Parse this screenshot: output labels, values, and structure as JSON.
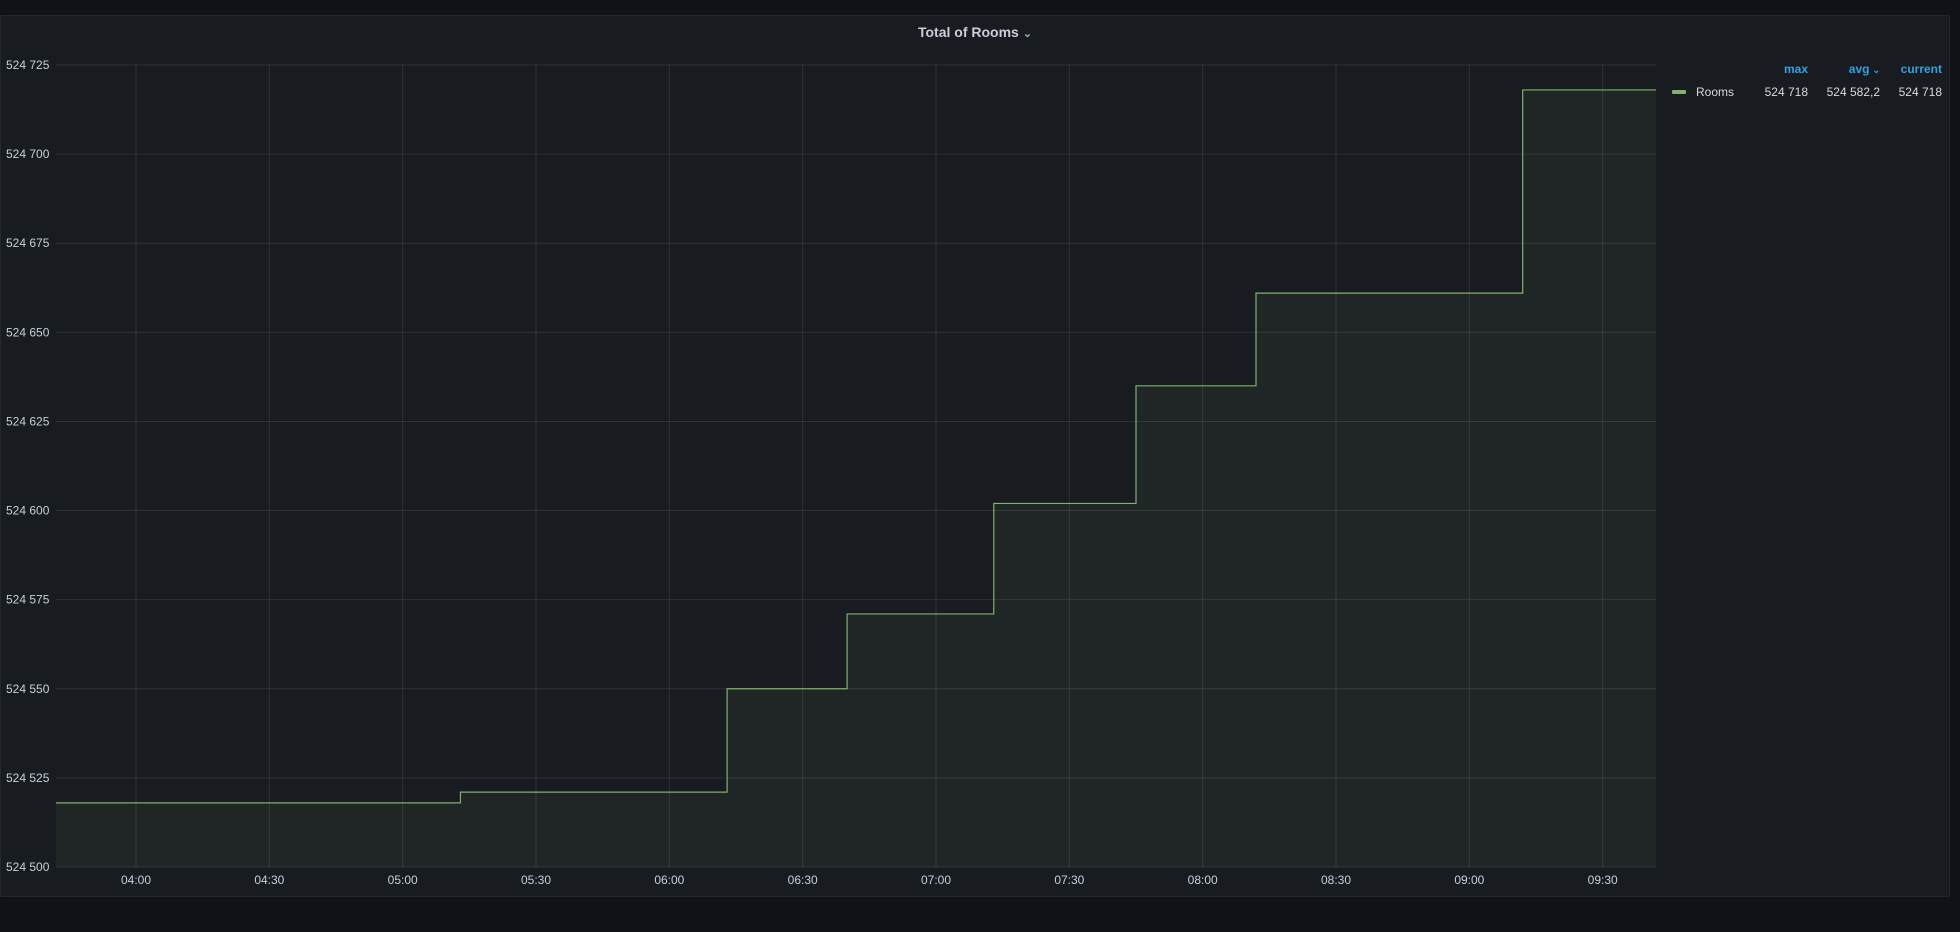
{
  "panel": {
    "title": "Total of Rooms",
    "menu_icon": "chevron-down-icon"
  },
  "legend": {
    "headers": {
      "max": "max",
      "avg": "avg",
      "current": "current"
    },
    "sort_icon": "chevron-down-icon",
    "series": [
      {
        "name": "Rooms",
        "color": "#7eb26d",
        "max": "524 718",
        "avg": "524 582,2",
        "current": "524 718"
      }
    ]
  },
  "chart_data": {
    "type": "area",
    "title": "Total of Rooms",
    "xlabel": "",
    "ylabel": "",
    "grid": true,
    "legend_position": "right",
    "step": true,
    "ylim": [
      524500,
      524725
    ],
    "xlim": [
      "03:42",
      "09:42"
    ],
    "yticks": [
      {
        "value": 524725,
        "label": "524 725"
      },
      {
        "value": 524700,
        "label": "524 700"
      },
      {
        "value": 524675,
        "label": "524 675"
      },
      {
        "value": 524650,
        "label": "524 650"
      },
      {
        "value": 524625,
        "label": "524 625"
      },
      {
        "value": 524600,
        "label": "524 600"
      },
      {
        "value": 524575,
        "label": "524 575"
      },
      {
        "value": 524550,
        "label": "524 550"
      },
      {
        "value": 524525,
        "label": "524 525"
      },
      {
        "value": 524500,
        "label": "524 500"
      }
    ],
    "xticks": [
      "04:00",
      "04:30",
      "05:00",
      "05:30",
      "06:00",
      "06:30",
      "07:00",
      "07:30",
      "08:00",
      "08:30",
      "09:00",
      "09:30"
    ],
    "series": [
      {
        "name": "Rooms",
        "color": "#7eb26d",
        "points": [
          {
            "x": "03:42",
            "y": 524518
          },
          {
            "x": "05:13",
            "y": 524521
          },
          {
            "x": "06:13",
            "y": 524550
          },
          {
            "x": "06:40",
            "y": 524571
          },
          {
            "x": "07:13",
            "y": 524602
          },
          {
            "x": "07:45",
            "y": 524635
          },
          {
            "x": "08:12",
            "y": 524661
          },
          {
            "x": "09:12",
            "y": 524718
          },
          {
            "x": "09:42",
            "y": 524718
          }
        ]
      }
    ]
  }
}
